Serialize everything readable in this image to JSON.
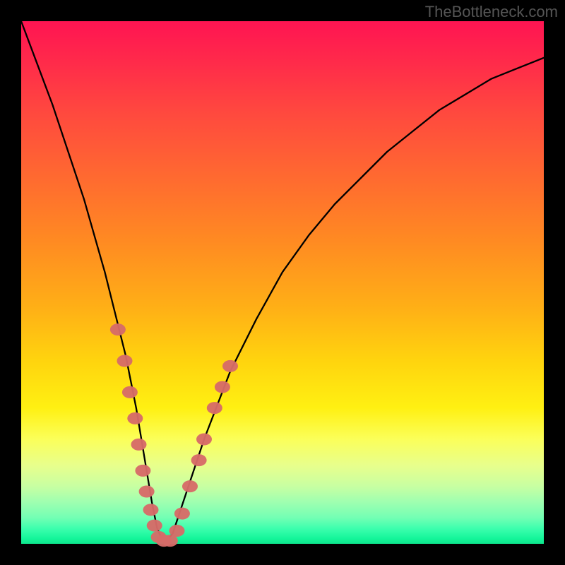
{
  "watermark": {
    "text": "TheBottleneck.com"
  },
  "chart_data": {
    "type": "line",
    "title": "",
    "xlabel": "",
    "ylabel": "",
    "xlim": [
      0,
      100
    ],
    "ylim": [
      0,
      100
    ],
    "series": [
      {
        "name": "bottleneck-curve",
        "x": [
          0,
          3,
          6,
          9,
          12,
          14,
          16,
          18,
          20,
          22,
          23,
          24,
          25,
          26,
          27,
          27.5,
          28,
          29,
          30,
          32,
          35,
          40,
          45,
          50,
          55,
          60,
          65,
          70,
          75,
          80,
          85,
          90,
          95,
          100
        ],
        "y": [
          100,
          92,
          84,
          75,
          66,
          59,
          52,
          44,
          36,
          26,
          20,
          14,
          8,
          3,
          0.7,
          0.5,
          0.7,
          2,
          5,
          11,
          20,
          33,
          43,
          52,
          59,
          65,
          70,
          75,
          79,
          83,
          86,
          89,
          91,
          93
        ]
      }
    ],
    "markers": {
      "name": "fit-markers",
      "color": "#d66b68",
      "points": [
        {
          "x": 18.5,
          "y": 41
        },
        {
          "x": 19.8,
          "y": 35
        },
        {
          "x": 20.8,
          "y": 29
        },
        {
          "x": 21.8,
          "y": 24
        },
        {
          "x": 22.5,
          "y": 19
        },
        {
          "x": 23.3,
          "y": 14
        },
        {
          "x": 24.0,
          "y": 10
        },
        {
          "x": 24.8,
          "y": 6.5
        },
        {
          "x": 25.5,
          "y": 3.5
        },
        {
          "x": 26.3,
          "y": 1.3
        },
        {
          "x": 27.3,
          "y": 0.6
        },
        {
          "x": 28.5,
          "y": 0.6
        },
        {
          "x": 29.8,
          "y": 2.5
        },
        {
          "x": 30.8,
          "y": 5.8
        },
        {
          "x": 32.3,
          "y": 11
        },
        {
          "x": 34.0,
          "y": 16
        },
        {
          "x": 35.0,
          "y": 20
        },
        {
          "x": 37.0,
          "y": 26
        },
        {
          "x": 38.5,
          "y": 30
        },
        {
          "x": 40.0,
          "y": 34
        }
      ]
    }
  }
}
